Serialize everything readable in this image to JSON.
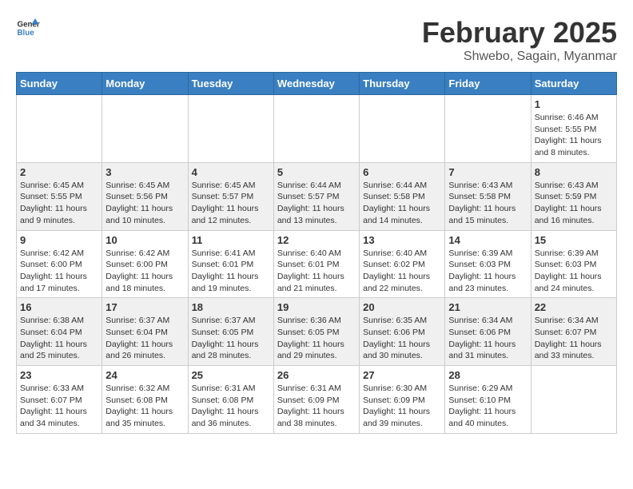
{
  "logo": {
    "text_general": "General",
    "text_blue": "Blue"
  },
  "title": "February 2025",
  "subtitle": "Shwebo, Sagain, Myanmar",
  "weekdays": [
    "Sunday",
    "Monday",
    "Tuesday",
    "Wednesday",
    "Thursday",
    "Friday",
    "Saturday"
  ],
  "weeks": [
    [
      {
        "day": "",
        "info": ""
      },
      {
        "day": "",
        "info": ""
      },
      {
        "day": "",
        "info": ""
      },
      {
        "day": "",
        "info": ""
      },
      {
        "day": "",
        "info": ""
      },
      {
        "day": "",
        "info": ""
      },
      {
        "day": "1",
        "info": "Sunrise: 6:46 AM\nSunset: 5:55 PM\nDaylight: 11 hours and 8 minutes."
      }
    ],
    [
      {
        "day": "2",
        "info": "Sunrise: 6:45 AM\nSunset: 5:55 PM\nDaylight: 11 hours and 9 minutes."
      },
      {
        "day": "3",
        "info": "Sunrise: 6:45 AM\nSunset: 5:56 PM\nDaylight: 11 hours and 10 minutes."
      },
      {
        "day": "4",
        "info": "Sunrise: 6:45 AM\nSunset: 5:57 PM\nDaylight: 11 hours and 12 minutes."
      },
      {
        "day": "5",
        "info": "Sunrise: 6:44 AM\nSunset: 5:57 PM\nDaylight: 11 hours and 13 minutes."
      },
      {
        "day": "6",
        "info": "Sunrise: 6:44 AM\nSunset: 5:58 PM\nDaylight: 11 hours and 14 minutes."
      },
      {
        "day": "7",
        "info": "Sunrise: 6:43 AM\nSunset: 5:58 PM\nDaylight: 11 hours and 15 minutes."
      },
      {
        "day": "8",
        "info": "Sunrise: 6:43 AM\nSunset: 5:59 PM\nDaylight: 11 hours and 16 minutes."
      }
    ],
    [
      {
        "day": "9",
        "info": "Sunrise: 6:42 AM\nSunset: 6:00 PM\nDaylight: 11 hours and 17 minutes."
      },
      {
        "day": "10",
        "info": "Sunrise: 6:42 AM\nSunset: 6:00 PM\nDaylight: 11 hours and 18 minutes."
      },
      {
        "day": "11",
        "info": "Sunrise: 6:41 AM\nSunset: 6:01 PM\nDaylight: 11 hours and 19 minutes."
      },
      {
        "day": "12",
        "info": "Sunrise: 6:40 AM\nSunset: 6:01 PM\nDaylight: 11 hours and 21 minutes."
      },
      {
        "day": "13",
        "info": "Sunrise: 6:40 AM\nSunset: 6:02 PM\nDaylight: 11 hours and 22 minutes."
      },
      {
        "day": "14",
        "info": "Sunrise: 6:39 AM\nSunset: 6:03 PM\nDaylight: 11 hours and 23 minutes."
      },
      {
        "day": "15",
        "info": "Sunrise: 6:39 AM\nSunset: 6:03 PM\nDaylight: 11 hours and 24 minutes."
      }
    ],
    [
      {
        "day": "16",
        "info": "Sunrise: 6:38 AM\nSunset: 6:04 PM\nDaylight: 11 hours and 25 minutes."
      },
      {
        "day": "17",
        "info": "Sunrise: 6:37 AM\nSunset: 6:04 PM\nDaylight: 11 hours and 26 minutes."
      },
      {
        "day": "18",
        "info": "Sunrise: 6:37 AM\nSunset: 6:05 PM\nDaylight: 11 hours and 28 minutes."
      },
      {
        "day": "19",
        "info": "Sunrise: 6:36 AM\nSunset: 6:05 PM\nDaylight: 11 hours and 29 minutes."
      },
      {
        "day": "20",
        "info": "Sunrise: 6:35 AM\nSunset: 6:06 PM\nDaylight: 11 hours and 30 minutes."
      },
      {
        "day": "21",
        "info": "Sunrise: 6:34 AM\nSunset: 6:06 PM\nDaylight: 11 hours and 31 minutes."
      },
      {
        "day": "22",
        "info": "Sunrise: 6:34 AM\nSunset: 6:07 PM\nDaylight: 11 hours and 33 minutes."
      }
    ],
    [
      {
        "day": "23",
        "info": "Sunrise: 6:33 AM\nSunset: 6:07 PM\nDaylight: 11 hours and 34 minutes."
      },
      {
        "day": "24",
        "info": "Sunrise: 6:32 AM\nSunset: 6:08 PM\nDaylight: 11 hours and 35 minutes."
      },
      {
        "day": "25",
        "info": "Sunrise: 6:31 AM\nSunset: 6:08 PM\nDaylight: 11 hours and 36 minutes."
      },
      {
        "day": "26",
        "info": "Sunrise: 6:31 AM\nSunset: 6:09 PM\nDaylight: 11 hours and 38 minutes."
      },
      {
        "day": "27",
        "info": "Sunrise: 6:30 AM\nSunset: 6:09 PM\nDaylight: 11 hours and 39 minutes."
      },
      {
        "day": "28",
        "info": "Sunrise: 6:29 AM\nSunset: 6:10 PM\nDaylight: 11 hours and 40 minutes."
      },
      {
        "day": "",
        "info": ""
      }
    ]
  ]
}
